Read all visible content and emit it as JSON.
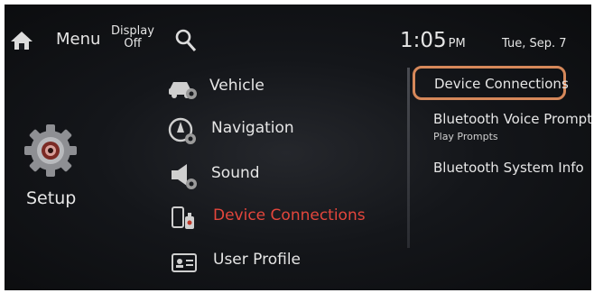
{
  "header": {
    "home_icon": "home-icon",
    "menu_label": "Menu",
    "display_off_line1": "Display",
    "display_off_line2": "Off",
    "search_icon": "search-icon",
    "time": "1:05",
    "ampm": "PM",
    "date": "Tue, Sep. 7"
  },
  "sidebar": {
    "icon": "gear-icon",
    "title": "Setup"
  },
  "menu": {
    "items": [
      {
        "label": "Vehicle",
        "icon": "car-gear-icon"
      },
      {
        "label": "Navigation",
        "icon": "navigation-gear-icon"
      },
      {
        "label": "Sound",
        "icon": "speaker-gear-icon"
      },
      {
        "label": "Device Connections",
        "icon": "phone-usb-icon",
        "selected": true
      },
      {
        "label": "User Profile",
        "icon": "profile-card-icon"
      }
    ]
  },
  "submenu": {
    "items": [
      {
        "label": "Device Connections",
        "highlighted": true
      },
      {
        "label": "Bluetooth Voice Prompts",
        "sublabel": "Play Prompts"
      },
      {
        "label": "Bluetooth System Info"
      }
    ]
  },
  "colors": {
    "selected_text": "#e4463c",
    "highlight_outline": "#d6885a",
    "text": "#e6e6e6"
  }
}
